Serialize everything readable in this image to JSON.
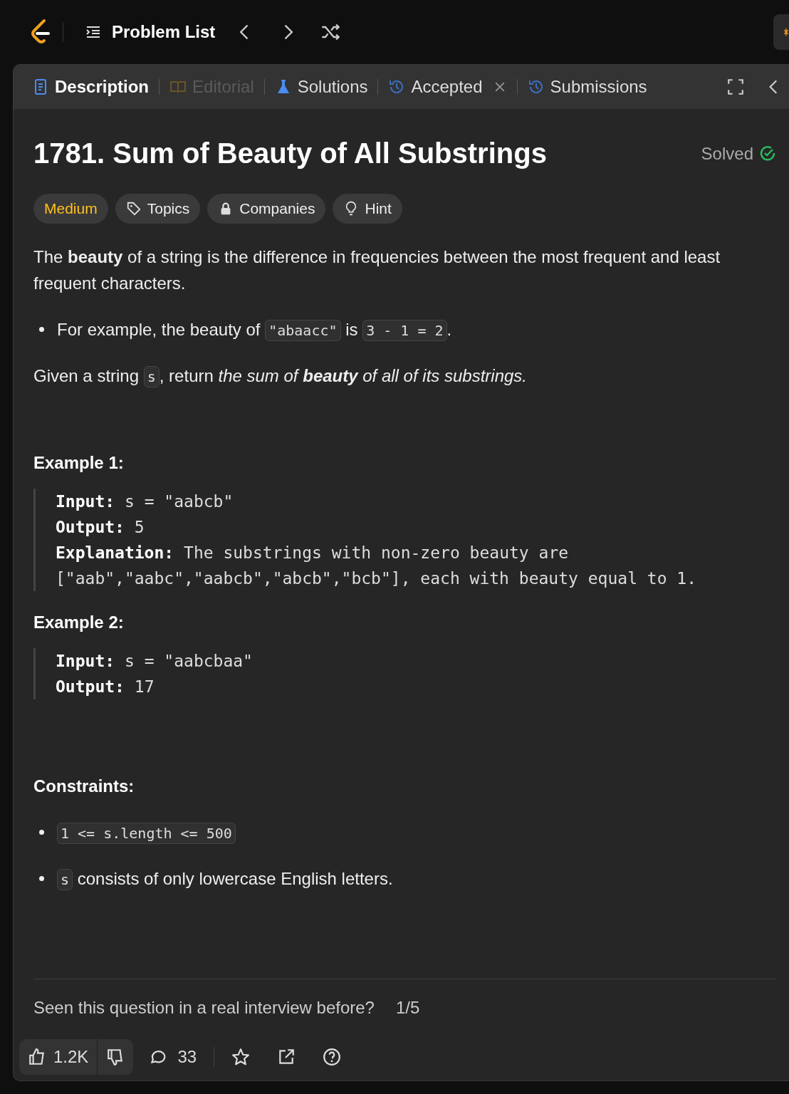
{
  "nav": {
    "title": "Problem List"
  },
  "tabs": [
    {
      "label": "Description",
      "kind": "doc",
      "selected": true,
      "disabled": false,
      "closable": false
    },
    {
      "label": "Editorial",
      "kind": "book",
      "selected": false,
      "disabled": true,
      "closable": false
    },
    {
      "label": "Solutions",
      "kind": "flask",
      "selected": false,
      "disabled": false,
      "closable": false
    },
    {
      "label": "Accepted",
      "kind": "history",
      "selected": false,
      "disabled": false,
      "closable": true
    },
    {
      "label": "Submissions",
      "kind": "history",
      "selected": false,
      "disabled": false,
      "closable": false
    }
  ],
  "problem": {
    "number": "1781.",
    "title": "Sum of Beauty of All Substrings",
    "status": "Solved",
    "difficulty": "Medium",
    "tags": [
      {
        "label": "Topics",
        "kind": "tag"
      },
      {
        "label": "Companies",
        "kind": "lock"
      },
      {
        "label": "Hint",
        "kind": "bulb"
      }
    ]
  },
  "description": [
    {
      "kind": "para",
      "segments": [
        {
          "kind": "text",
          "text": "The **beauty** of a string is the difference in frequencies between the most frequent and least frequent characters."
        }
      ]
    },
    {
      "kind": "bullet",
      "segments": [
        {
          "kind": "text",
          "text": "For example, the beauty of "
        },
        {
          "kind": "code",
          "text": "\"abaacc\""
        },
        {
          "kind": "text",
          "text": " is "
        },
        {
          "kind": "code",
          "text": "3 - 1 = 2"
        },
        {
          "kind": "text",
          "text": "."
        }
      ]
    },
    {
      "kind": "para",
      "segments": [
        {
          "kind": "text",
          "text": "Given a string "
        },
        {
          "kind": "code",
          "text": "s"
        },
        {
          "kind": "text",
          "text": ", return "
        },
        {
          "kind": "emph",
          "text": "the sum of **beauty** of all of its substrings."
        }
      ]
    }
  ],
  "examples": [
    {
      "title": "Example 1:",
      "lines": [
        {
          "label": "Input:",
          "value": "s = \"aabcb\""
        },
        {
          "label": "Output:",
          "value": "5"
        },
        {
          "label": "Explanation:",
          "value": "The substrings with non-zero beauty are\n[\"aab\",\"aabc\",\"aabcb\",\"abcb\",\"bcb\"], each with beauty equal to 1."
        }
      ]
    },
    {
      "title": "Example 2:",
      "lines": [
        {
          "label": "Input:",
          "value": "s = \"aabcbaa\""
        },
        {
          "label": "Output:",
          "value": "17"
        }
      ]
    }
  ],
  "constraints": {
    "title": "Constraints:",
    "items": [
      [
        {
          "kind": "code",
          "text": "1 <= s.length <= 500"
        }
      ],
      [
        {
          "kind": "code",
          "text": "s"
        },
        {
          "kind": "text",
          "text": " consists of only lowercase English letters."
        }
      ]
    ]
  },
  "feedback": {
    "question": "Seen this question in a real interview before?",
    "rating": "1/5"
  },
  "footer": {
    "likes": "1.2K",
    "comments": "33"
  }
}
